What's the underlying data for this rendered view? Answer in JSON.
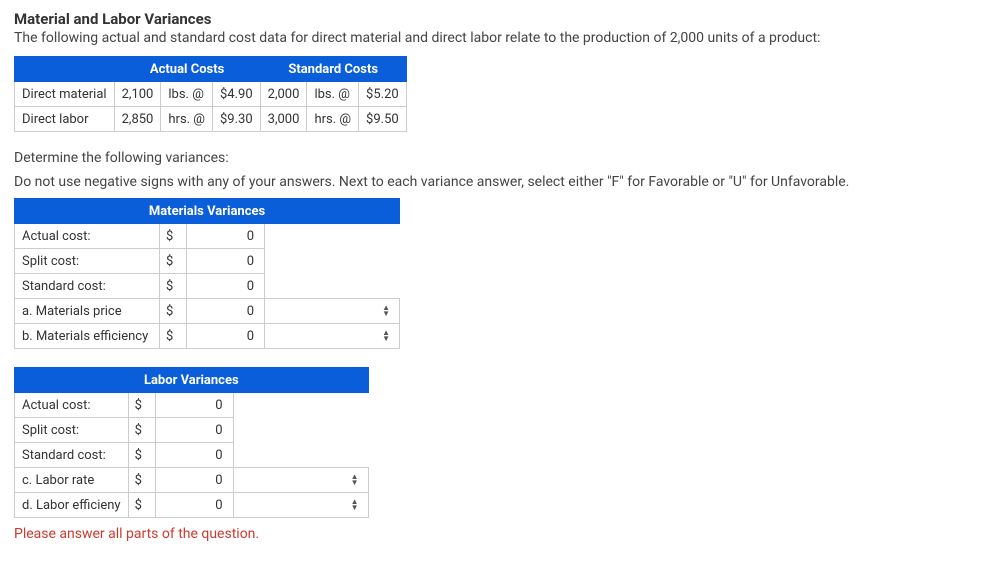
{
  "title": "Material and Labor Variances",
  "intro": "The following actual and standard cost data for direct material and direct labor relate to the production of 2,000 units of a product:",
  "cost_table": {
    "headers": {
      "actual": "Actual Costs",
      "standard": "Standard Costs"
    },
    "rows": [
      {
        "label": "Direct material",
        "a_qty": "2,100",
        "a_unit": "lbs. @",
        "a_price": "$4.90",
        "s_qty": "2,000",
        "s_unit": "lbs. @",
        "s_price": "$5.20"
      },
      {
        "label": "Direct labor",
        "a_qty": "2,850",
        "a_unit": "hrs. @",
        "a_price": "$9.30",
        "s_qty": "3,000",
        "s_unit": "hrs. @",
        "s_price": "$9.50"
      }
    ]
  },
  "determine": "Determine the following variances:",
  "instructions": "Do not use negative signs with any of your answers. Next to each variance answer, select either \"F\" for Favorable or \"U\" for Unfavorable.",
  "materials": {
    "header": "Materials Variances",
    "rows": [
      {
        "label": "Actual cost:",
        "sign": "$",
        "value": "0",
        "select": false
      },
      {
        "label": "Split cost:",
        "sign": "$",
        "value": "0",
        "select": false
      },
      {
        "label": "Standard cost:",
        "sign": "$",
        "value": "0",
        "select": false
      },
      {
        "label": "a. Materials price",
        "sign": "$",
        "value": "0",
        "select": true
      },
      {
        "label": "b. Materials efficiency",
        "sign": "$",
        "value": "0",
        "select": true
      }
    ]
  },
  "labor": {
    "header": "Labor Variances",
    "rows": [
      {
        "label": "Actual cost:",
        "sign": "$",
        "value": "0",
        "select": false
      },
      {
        "label": "Split cost:",
        "sign": "$",
        "value": "0",
        "select": false
      },
      {
        "label": "Standard cost:",
        "sign": "$",
        "value": "0",
        "select": false
      },
      {
        "label": "c. Labor rate",
        "sign": "$",
        "value": "0",
        "select": true
      },
      {
        "label": "d. Labor efficieny",
        "sign": "$",
        "value": "0",
        "select": true
      }
    ]
  },
  "warning": "Please answer all parts of the question."
}
